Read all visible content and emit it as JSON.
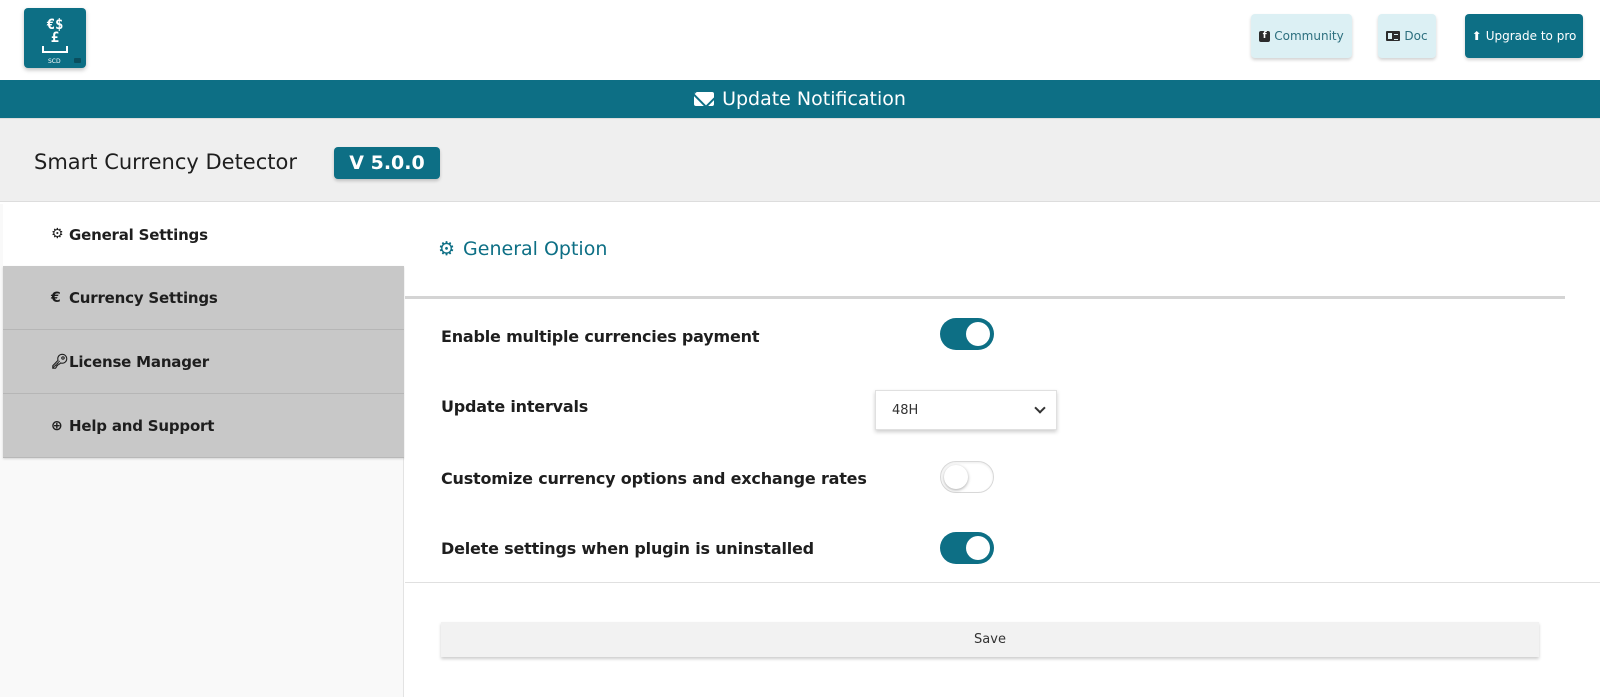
{
  "topbar": {
    "logo_symbols": "€$\n£",
    "logo_caption": "SCD",
    "community_label": "Community",
    "doc_label": "Doc",
    "upgrade_label": "Upgrade to pro"
  },
  "notification": {
    "label": "Update Notification"
  },
  "header": {
    "title": "Smart Currency Detector",
    "version": "V 5.0.0"
  },
  "sidebar": {
    "items": [
      {
        "icon": "gear-icon",
        "label": "General Settings",
        "active": true
      },
      {
        "icon": "euro-icon",
        "label": "Currency Settings",
        "active": false
      },
      {
        "icon": "key-icon",
        "label": "License Manager",
        "active": false
      },
      {
        "icon": "lifebuoy-icon",
        "label": "Help and Support",
        "active": false
      }
    ]
  },
  "main": {
    "section_title": "General Option",
    "options": [
      {
        "label": "Enable multiple currencies payment",
        "type": "toggle",
        "value": true
      },
      {
        "label": "Update intervals",
        "type": "select",
        "value": "48H"
      },
      {
        "label": "Customize currency options and exchange rates",
        "type": "toggle",
        "value": false
      },
      {
        "label": "Delete settings when plugin is uninstalled",
        "type": "toggle",
        "value": true
      }
    ],
    "save_label": "Save"
  },
  "colors": {
    "accent": "#0d6f85",
    "sidebar_inactive": "#c8c8c8",
    "header_bg": "#efefef"
  }
}
